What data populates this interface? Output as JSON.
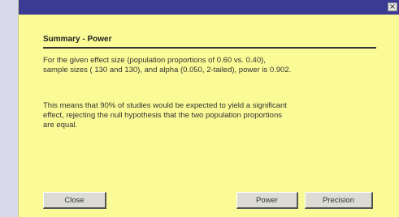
{
  "window": {
    "close_glyph": "×"
  },
  "summary": {
    "heading": "Summary - Power",
    "paragraph1": "For the given effect size (population proportions of  0.60 vs.  0.40),\nsample sizes ( 130 and  130), and alpha (0.050, 2-tailed), power is 0.902.",
    "paragraph2": "This means that 90% of studies would be expected to yield a significant\neffect, rejecting the null hypothesis that the two population proportions\nare equal."
  },
  "buttons": {
    "close_label": "Close",
    "power_label": "Power",
    "precision_label": "Precision"
  },
  "colors": {
    "titlebar": "#3b3b94",
    "panel": "#fafa96",
    "background": "#d9d9e9"
  }
}
